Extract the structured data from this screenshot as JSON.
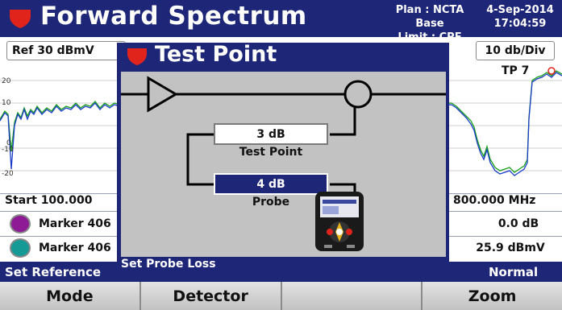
{
  "header": {
    "title": "Forward Spectrum",
    "plan_line": "Plan : NCTA Base",
    "limit_line": "Limit : CPE",
    "date": "4-Sep-2014",
    "time": "17:04:59",
    "icon": "shield-logo-icon"
  },
  "graph": {
    "ref_level": "Ref 30 dBmV",
    "scale": "10 db/Div",
    "tp_label": "TP 7",
    "y_labels": [
      "20",
      "10",
      "0",
      "-10",
      "-20"
    ]
  },
  "info": {
    "start": "Start 100.000",
    "stop": "800.000 MHz",
    "marker1_label": "Marker 406",
    "marker1_value": "0.0 dB",
    "marker2_label": "Marker 406",
    "marker2_value": "25.9 dBmV"
  },
  "status": {
    "left": "Set Reference",
    "right": "Normal"
  },
  "softkeys": [
    "Mode",
    "Detector",
    "",
    "Zoom"
  ],
  "dialog": {
    "title": "Test Point",
    "test_point_value": "3 dB",
    "test_point_label": "Test Point",
    "probe_value": "4 dB",
    "probe_label": "Probe",
    "status": "Set Probe Loss"
  },
  "colors": {
    "header_bg": "#1d2677",
    "logo_red": "#e0241b",
    "trace_blue": "#1a3cc8",
    "trace_green": "#18a01a",
    "marker1": "#8e1a96",
    "marker2": "#169a96"
  }
}
